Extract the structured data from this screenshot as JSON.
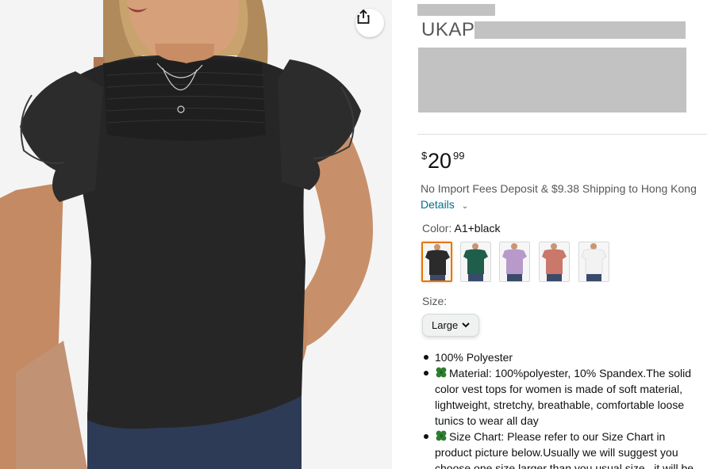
{
  "product": {
    "brand": "UKAP",
    "price": {
      "symbol": "$",
      "whole": "20",
      "fraction": "99"
    },
    "shipping_text": "No Import Fees Deposit & $9.38 Shipping to Hong Kong",
    "details_link": "Details",
    "color_label": "Color:",
    "color_value": "A1+black",
    "size_label": "Size:",
    "size_value": "Large",
    "bullets": [
      "100% Polyester",
      "Material: 100%polyester, 10% Spandex.The solid color vest tops for women is made of soft material, lightweight, stretchy, breathable, comfortable loose tunics to wear all day",
      "Size Chart: Please refer to our Size Chart in product picture below.Usually we will suggest you choose one size larger than you usual size , it will be"
    ]
  },
  "swatches": [
    {
      "color": "#2b2b2b"
    },
    {
      "color": "#1f5e4a"
    },
    {
      "color": "#b79ac9"
    },
    {
      "color": "#c9786a"
    },
    {
      "color": "#f2f2f2"
    }
  ],
  "colors": {
    "link": "#007185",
    "selected_border": "#e77600",
    "redaction": "#c2c2c2",
    "shirt": "#262626"
  },
  "icons": {
    "share": "share-icon",
    "size_chevron": "chevron-down-icon",
    "details_chevron": "chevron-down-icon",
    "bullet_emoji": "four-leaf-clover-icon"
  }
}
